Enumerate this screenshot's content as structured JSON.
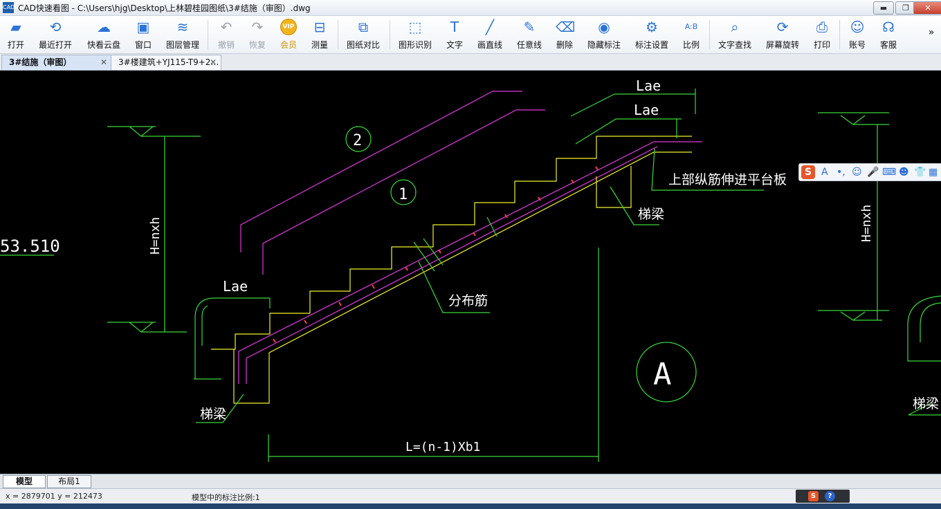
{
  "window": {
    "title": "CAD快速看图 - C:\\Users\\hjg\\Desktop\\上林碧桂园图纸\\3#结施（审图）.dwg",
    "app_icon_text": "CAD",
    "minimize": "▬",
    "maximize": "❐",
    "close": "✕"
  },
  "toolbar": {
    "items": [
      {
        "label": "打开",
        "icon": "▰"
      },
      {
        "label": "最近打开",
        "icon": "⟲"
      },
      {
        "label": "快看云盘",
        "icon": "☁"
      },
      {
        "label": "窗口",
        "icon": "▣"
      },
      {
        "label": "图层管理",
        "icon": "≋"
      },
      {
        "label": "撤销",
        "icon": "↶"
      },
      {
        "label": "恢复",
        "icon": "↷"
      },
      {
        "label": "会员",
        "icon": "VIP"
      },
      {
        "label": "测量",
        "icon": "⊟"
      },
      {
        "label": "图纸对比",
        "icon": "⧉"
      },
      {
        "label": "图形识别",
        "icon": "⬚"
      },
      {
        "label": "文字",
        "icon": "T"
      },
      {
        "label": "画直线",
        "icon": "╱"
      },
      {
        "label": "任意线",
        "icon": "✎"
      },
      {
        "label": "删除",
        "icon": "⌫"
      },
      {
        "label": "隐藏标注",
        "icon": "◉"
      },
      {
        "label": "标注设置",
        "icon": "⚙"
      },
      {
        "label": "比例",
        "icon": "A:B"
      },
      {
        "label": "文字查找",
        "icon": "⌕"
      },
      {
        "label": "屏幕旋转",
        "icon": "⟳"
      },
      {
        "label": "打印",
        "icon": "⎙"
      },
      {
        "label": "账号",
        "icon": "☺"
      },
      {
        "label": "客服",
        "icon": "☊"
      }
    ],
    "overflow": "»"
  },
  "tabs": [
    {
      "label": "3#结施（审图）",
      "close": "✕"
    },
    {
      "label": "3#楼建筑+YJ115-T9+2…",
      "close": "✕"
    }
  ],
  "drawing": {
    "lae_top1": "Lae",
    "lae_top2": "Lae",
    "lae_left": "Lae",
    "circle2": "2",
    "circle1": "1",
    "circleA": "A",
    "elev": "53.510",
    "h_left": "H=nxh",
    "h_right": "H=nxh",
    "top_note": "上部纵筋伸进平台板",
    "beam_right": "梯梁",
    "beam_left": "梯梁",
    "beam_far_right": "梯梁",
    "dist_bar": "分布筋",
    "length": "L=(n-1)Xb1"
  },
  "layout_tabs": [
    {
      "label": "模型"
    },
    {
      "label": "布局1"
    }
  ],
  "status": {
    "coords": "x = 2879701  y = 212473",
    "scale": "模型中的标注比例:1"
  },
  "ime": {
    "s": "S",
    "help": "?"
  },
  "float_ime": {
    "s": "S",
    "items": [
      "A",
      "•,",
      "☺",
      "🎤",
      "⌨",
      "☻",
      "👕",
      "▦"
    ]
  }
}
